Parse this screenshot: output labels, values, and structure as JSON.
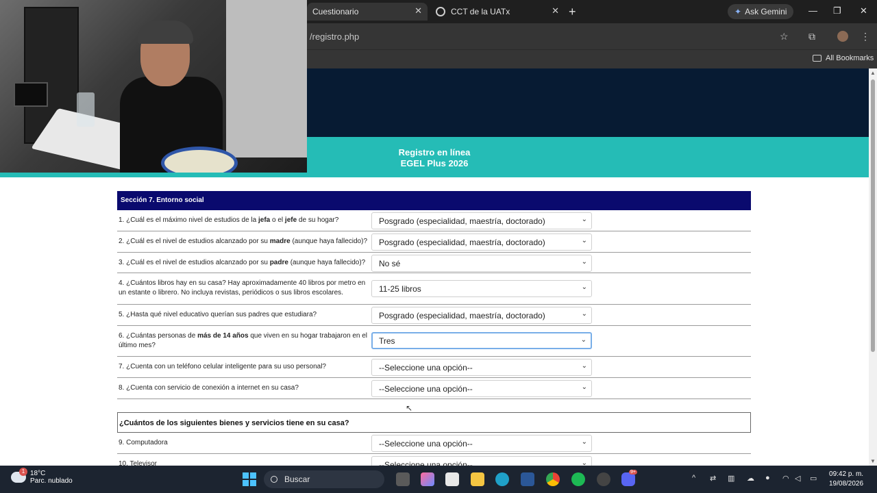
{
  "browser": {
    "tabs": [
      {
        "label": "Cuestionario",
        "active": true
      },
      {
        "label": "CCT de la UATx",
        "active": false
      }
    ],
    "ask_gemini": "Ask Gemini",
    "url": "/registro.php",
    "all_bookmarks": "All Bookmarks"
  },
  "page": {
    "banner_title_line1": "Registro en línea",
    "banner_title_line2": "EGEL Plus 2026",
    "section_title": "Sección 7. Entorno social",
    "questions": [
      {
        "text": "1. ¿Cuál es el máximo nivel de estudios de la jefa o el jefe de su hogar?",
        "answer": "Posgrado (especialidad, maestría, doctorado)"
      },
      {
        "text": "2. ¿Cuál es el nivel de estudios alcanzado por su madre (aunque haya fallecido)?",
        "answer": "Posgrado (especialidad, maestría, doctorado)"
      },
      {
        "text": "3. ¿Cuál es el nivel de estudios alcanzado por su padre (aunque haya fallecido)?",
        "answer": "No sé"
      },
      {
        "text": "4. ¿Cuántos libros hay en su casa? Hay aproximadamente 40 libros por metro en un estante o librero. No incluya revistas, periódicos o sus libros escolares.",
        "answer": "11-25 libros"
      },
      {
        "text": "5. ¿Hasta qué nivel educativo querían sus padres que estudiara?",
        "answer": "Posgrado (especialidad, maestría, doctorado)"
      },
      {
        "text": "6. ¿Cuántas personas de más de 14 años que viven en su hogar trabajaron en el último mes?",
        "answer": "Tres"
      },
      {
        "text": "7. ¿Cuenta con un teléfono celular inteligente para su uso personal?",
        "answer": "--Seleccione una opción--"
      },
      {
        "text": "8. ¿Cuenta con servicio de conexión a internet en su casa?",
        "answer": "--Seleccione una opción--"
      }
    ],
    "subsection_title": "¿Cuántos de los siguientes bienes y servicios tiene en su casa?",
    "goods": [
      {
        "text": "9. Computadora",
        "answer": "--Seleccione una opción--"
      },
      {
        "text": "10. Televisor",
        "answer": "--Seleccione una opción--"
      }
    ]
  },
  "taskbar": {
    "weather_temp": "18°C",
    "weather_desc": "Parc. nublado",
    "weather_badge": "1",
    "search_label": "Buscar",
    "time": "09:42 p. m.",
    "date": "19/08/2026",
    "discord_badge": "9+"
  },
  "colors": {
    "banner_dark": "#071b33",
    "banner_teal": "#25bcb6",
    "section_header": "#0a0a6e"
  }
}
